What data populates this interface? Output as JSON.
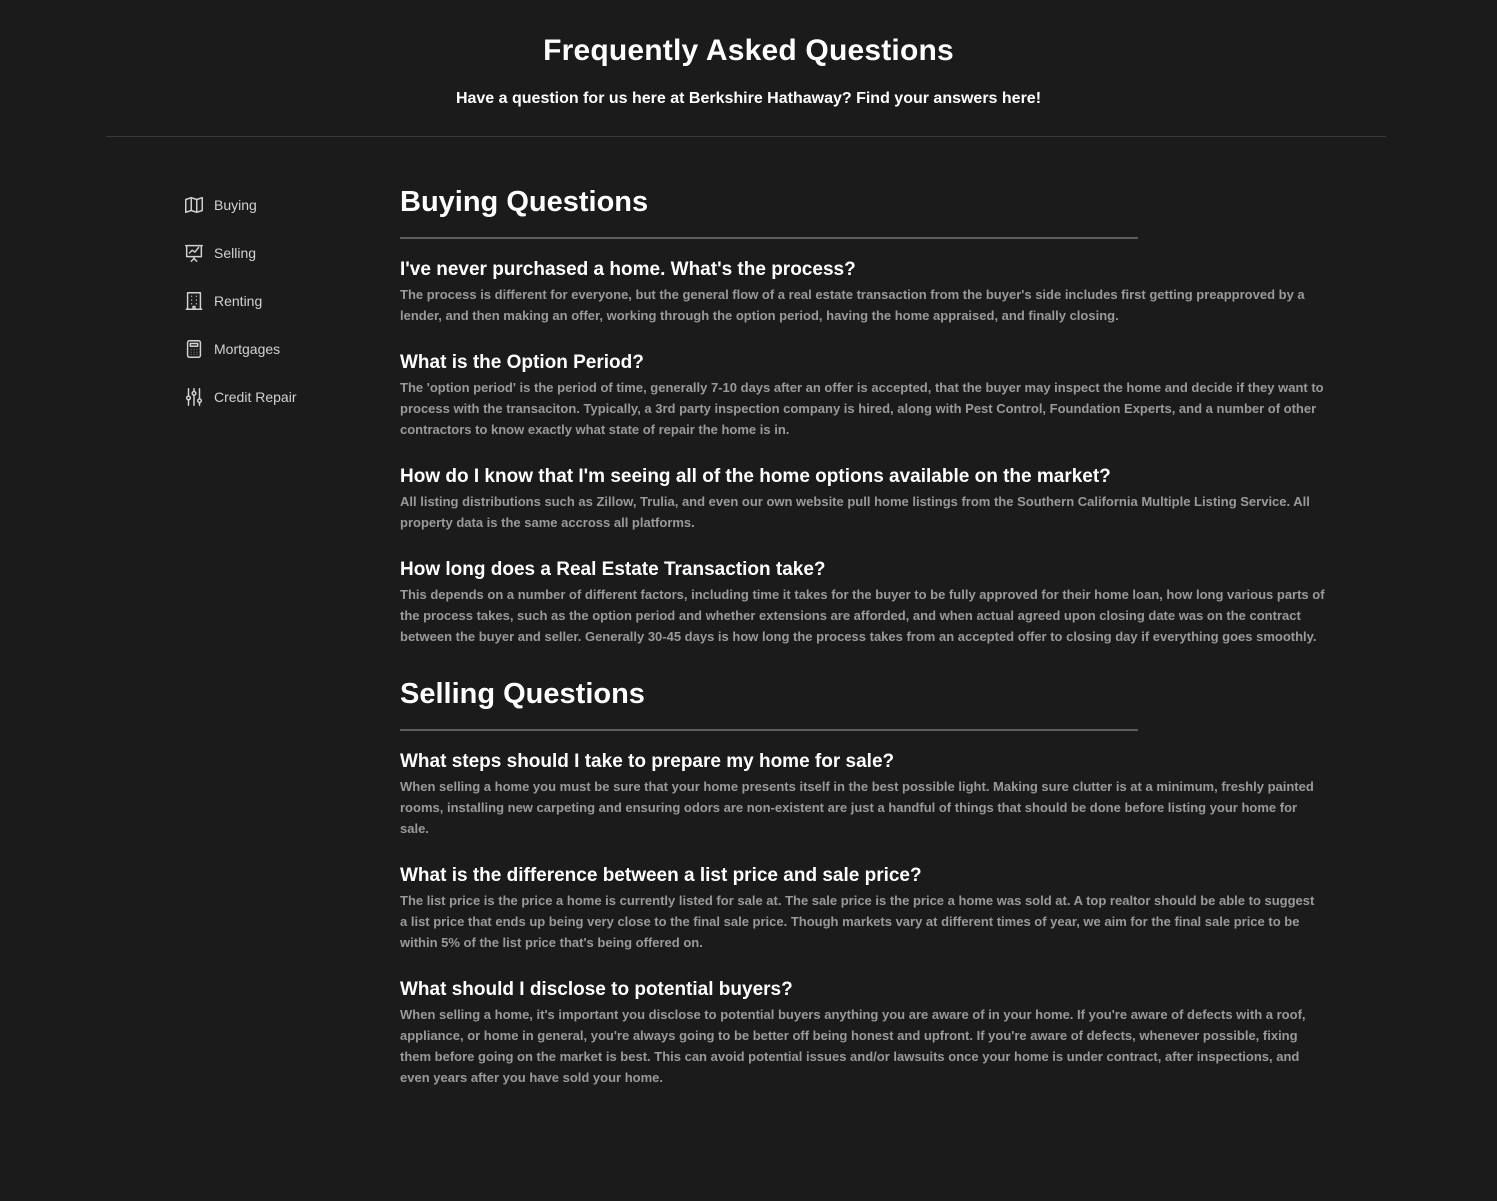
{
  "header": {
    "title": "Frequently Asked Questions",
    "subtitle": "Have a question for us here at Berkshire Hathaway? Find your answers here!"
  },
  "sidebar": {
    "items": [
      {
        "label": "Buying",
        "icon": "map-icon"
      },
      {
        "label": "Selling",
        "icon": "presentation-chart-icon"
      },
      {
        "label": "Renting",
        "icon": "building-icon"
      },
      {
        "label": "Mortgages",
        "icon": "calculator-icon"
      },
      {
        "label": "Credit Repair",
        "icon": "adjustments-icon"
      }
    ]
  },
  "sections": [
    {
      "title": "Buying Questions",
      "items": [
        {
          "q": "I've never purchased a home. What's the process?",
          "a": "The process is different for everyone, but the general flow of a real estate transaction from the buyer's side includes first getting preapproved by a lender, and then making an offer, working through the option period, having the home appraised, and finally closing."
        },
        {
          "q": "What is the Option Period?",
          "a": "The 'option period' is the period of time, generally 7-10 days after an offer is accepted, that the buyer may inspect the home and decide if they want to process with the transaciton. Typically, a 3rd party inspection company is hired, along with Pest Control, Foundation Experts, and a number of other contractors to know exactly what state of repair the home is in."
        },
        {
          "q": "How do I know that I'm seeing all of the home options available on the market?",
          "a": "All listing distributions such as Zillow, Trulia, and even our own website pull home listings from the Southern California Multiple Listing Service. All property data is the same accross all platforms."
        },
        {
          "q": "How long does a Real Estate Transaction take?",
          "a": "This depends on a number of different factors, including time it takes for the buyer to be fully approved for their home loan, how long various parts of the process takes, such as the option period and whether extensions are afforded, and when actual agreed upon closing date was on the contract between the buyer and seller. Generally 30-45 days is how long the process takes from an accepted offer to closing day if everything goes smoothly."
        }
      ]
    },
    {
      "title": "Selling Questions",
      "items": [
        {
          "q": "What steps should I take to prepare my home for sale?",
          "a": "When selling a home you must be sure that your home presents itself in the best possible light. Making sure clutter is at a minimum, freshly painted rooms, installing new carpeting and ensuring odors are non-existent are just a handful of things that should be done before listing your home for sale."
        },
        {
          "q": "What is the difference between a list price and sale price?",
          "a": "The list price is the price a home is currently listed for sale at. The sale price is the price a home was sold at. A top realtor should be able to suggest a list price that ends up being very close to the final sale price. Though markets vary at different times of year, we aim for the final sale price to be within 5% of the list price that's being offered on."
        },
        {
          "q": "What should I disclose to potential buyers?",
          "a": "When selling a home, it's important you disclose to potential buyers anything you are aware of in your home. If you're aware of defects with a roof, appliance, or home in general, you're always going to be better off being honest and upfront. If you're aware of defects, whenever possible, fixing them before going on the market is best. This can avoid potential issues and/or lawsuits once your home is under contract, after inspections, and even years after you have sold your home."
        }
      ]
    }
  ]
}
